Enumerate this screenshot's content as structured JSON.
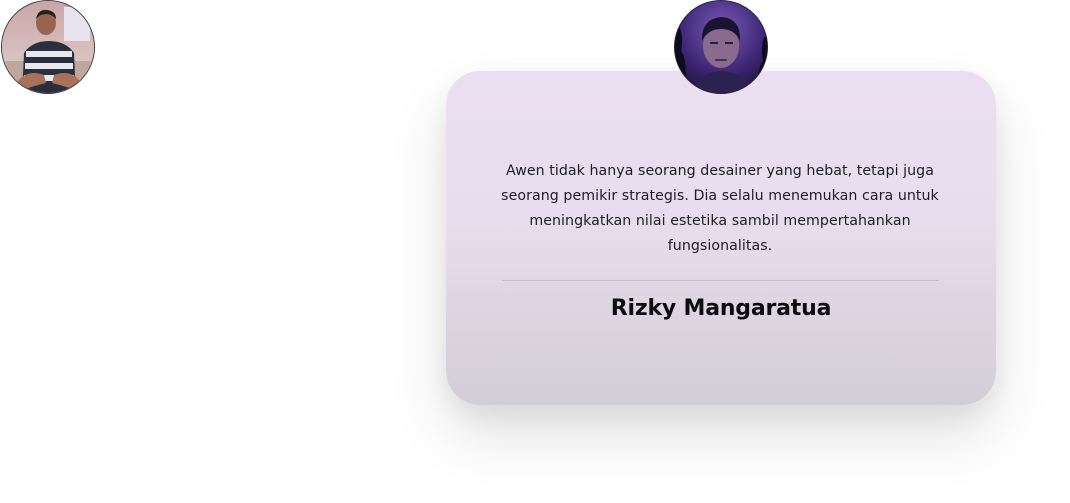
{
  "testimonials": {
    "previous": {
      "avatar_alt": "person-avatar"
    },
    "active": {
      "quote": "Awen tidak hanya seorang desainer yang hebat, tetapi juga seorang pemikir strategis. Dia selalu menemukan cara untuk meningkatkan nilai estetika sambil mempertahankan fungsionalitas.",
      "name": "Rizky Mangaratua"
    }
  },
  "colors": {
    "card_top": "#eadff1",
    "card_bottom": "#d2ced6",
    "text": "#1d1d22",
    "divider": "#c2bcc6"
  }
}
